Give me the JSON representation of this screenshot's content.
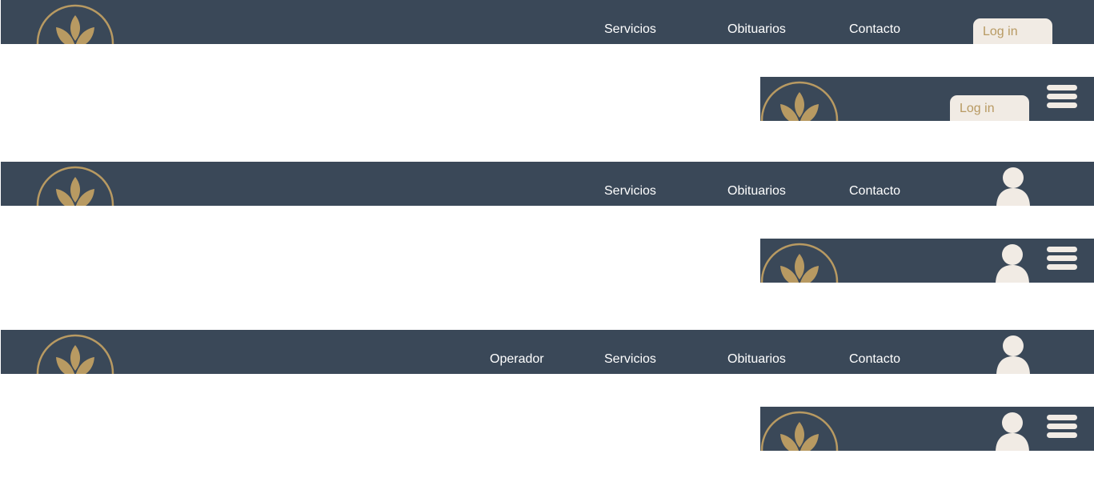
{
  "colors": {
    "header_bg": "#3a4858",
    "gold": "#b89a62",
    "cream": "#f1ebe4",
    "nav_text": "#ffffff"
  },
  "icons": {
    "logo": "lotus-logo-icon",
    "user": "user-avatar-icon",
    "menu": "hamburger-menu-icon"
  },
  "header_desktop_guest": {
    "nav": [
      "Servicios",
      "Obituarios",
      "Contacto"
    ],
    "login_label": "Log in"
  },
  "header_mobile_guest": {
    "login_label": "Log in"
  },
  "header_desktop_user": {
    "nav": [
      "Servicios",
      "Obituarios",
      "Contacto"
    ]
  },
  "header_desktop_operator": {
    "nav": [
      "Operador",
      "Servicios",
      "Obituarios",
      "Contacto"
    ]
  }
}
